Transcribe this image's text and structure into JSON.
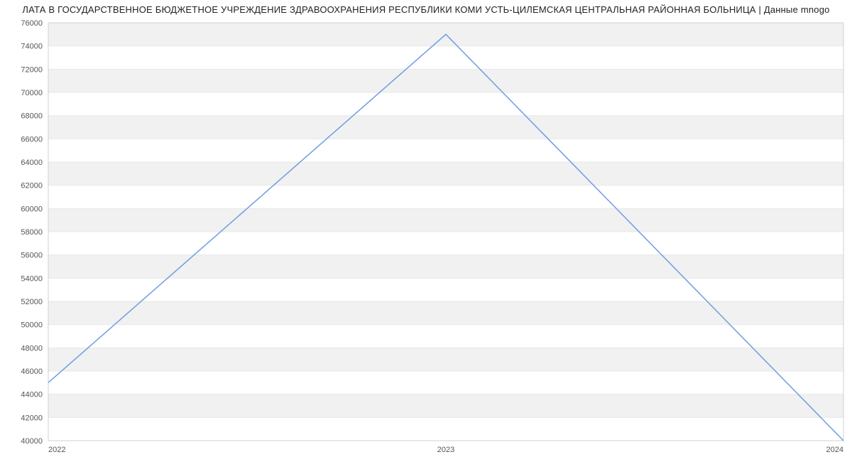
{
  "title": "ЛАТА В ГОСУДАРСТВЕННОЕ БЮДЖЕТНОЕ УЧРЕЖДЕНИЕ ЗДРАВООХРАНЕНИЯ РЕСПУБЛИКИ КОМИ УСТЬ-ЦИЛЕМСКАЯ ЦЕНТРАЛЬНАЯ РАЙОННАЯ БОЛЬНИЦА | Данные mnogo",
  "chart_data": {
    "type": "line",
    "categories": [
      "2022",
      "2023",
      "2024"
    ],
    "values": [
      45000,
      75000,
      40000
    ],
    "title": "",
    "xlabel": "",
    "ylabel": "",
    "ylim": [
      40000,
      76000
    ],
    "yticks": [
      40000,
      42000,
      44000,
      46000,
      48000,
      50000,
      52000,
      54000,
      56000,
      58000,
      60000,
      62000,
      64000,
      66000,
      68000,
      70000,
      72000,
      74000,
      76000
    ],
    "colors": {
      "line": "#6d9ee2",
      "band": "#f1f1f1"
    }
  }
}
